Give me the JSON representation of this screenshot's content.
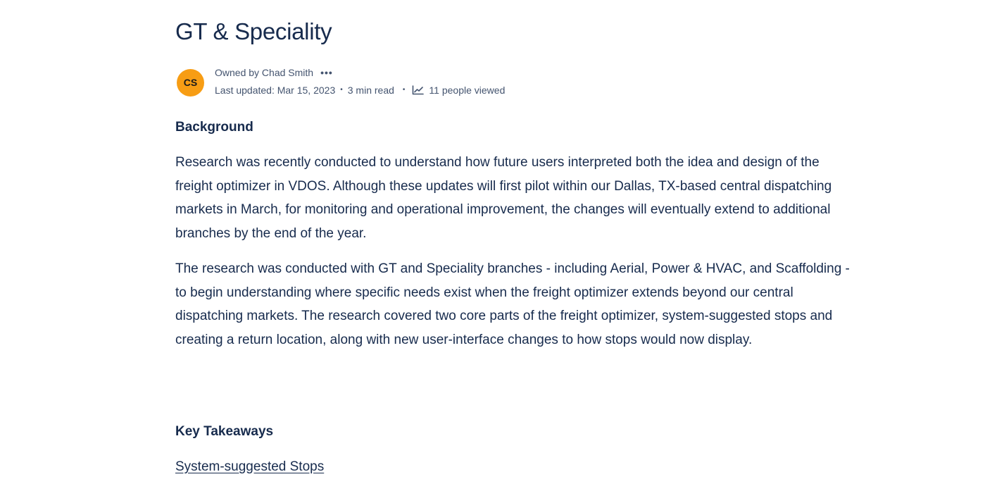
{
  "page": {
    "title": "GT & Speciality"
  },
  "byline": {
    "avatar_initials": "CS",
    "avatar_color": "#f79d14",
    "owner_text": "Owned by Chad Smith",
    "more_label": "•••",
    "last_updated": "Last updated: Mar 15, 2023",
    "separator": "•",
    "read_time": "3 min read",
    "views_icon": "analytics-chart-icon",
    "views_text": "11 people viewed"
  },
  "sections": {
    "background_heading": "Background",
    "background_p1": "Research was recently conducted to understand how future users interpreted both the idea and design of the freight optimizer in VDOS.  Although these updates will first pilot within our Dallas, TX-based central dispatching markets in March, for monitoring and operational improvement, the changes will eventually extend to additional branches by the end of the year.",
    "background_p2": "The research was conducted with GT and Speciality branches - including Aerial, Power & HVAC, and Scaffolding -  to begin understanding where specific needs exist when the freight optimizer extends beyond our central dispatching markets. The research covered two core parts of the freight optimizer, system-suggested stops and creating a return location, along with new user-interface changes to how stops would now display.",
    "takeaways_heading": "Key Takeaways",
    "takeaways_link": "System-suggested Stops"
  }
}
